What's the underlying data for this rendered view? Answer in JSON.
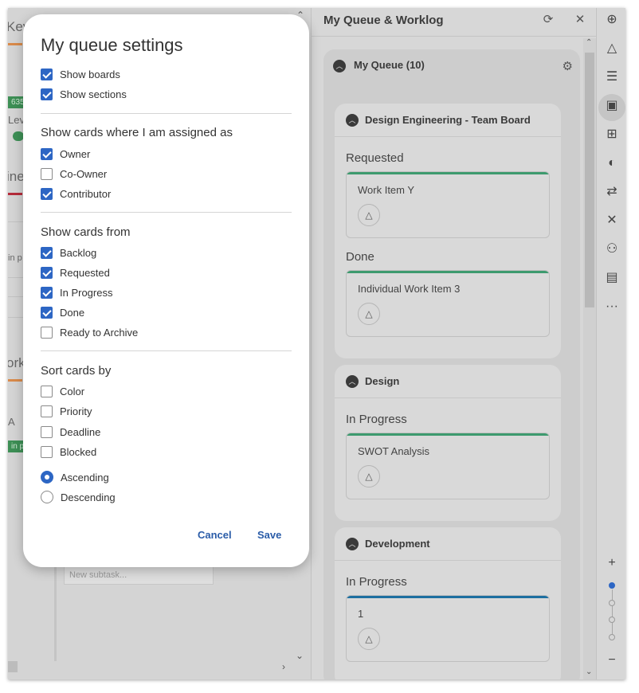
{
  "left_board": {
    "key_text": "Key",
    "id_badge": "635",
    "level_text": "Lev",
    "in_text": "in p",
    "ine_text": "ine",
    "work_text": "ork",
    "a_text": "A",
    "in_p_badge": "in pr",
    "new_subtask_placeholder": "New subtask..."
  },
  "panel": {
    "title": "My Queue & Worklog",
    "queue_title": "My Queue (10)",
    "boards": [
      {
        "title": "Design Engineering - Team Board",
        "columns": [
          {
            "label": "Requested",
            "card": "Work Item Y",
            "bar_color": "#3d9a6e"
          },
          {
            "label": "Done",
            "card": "Individual Work Item 3",
            "bar_color": "#3d9a6e"
          }
        ]
      },
      {
        "title": "Design",
        "columns": [
          {
            "label": "In Progress",
            "card": "SWOT Analysis",
            "bar_color": "#3d9a6e"
          }
        ]
      },
      {
        "title": "Development",
        "columns": [
          {
            "label": "In Progress",
            "card": "1",
            "bar_color": "#1d6fa0"
          }
        ]
      }
    ]
  },
  "toolbar": {
    "more_label": "···",
    "zoom_in": "+",
    "zoom_out": "−"
  },
  "modal": {
    "title": "My queue settings",
    "show_boards": "Show boards",
    "show_sections": "Show sections",
    "assigned_title": "Show cards where I am assigned as",
    "owner": "Owner",
    "co_owner": "Co-Owner",
    "contributor": "Contributor",
    "from_title": "Show cards from",
    "backlog": "Backlog",
    "requested": "Requested",
    "in_progress": "In Progress",
    "done": "Done",
    "ready_to_archive": "Ready to Archive",
    "sort_title": "Sort cards by",
    "color": "Color",
    "priority": "Priority",
    "deadline": "Deadline",
    "blocked": "Blocked",
    "ascending": "Ascending",
    "descending": "Descending",
    "cancel": "Cancel",
    "save": "Save",
    "checked": {
      "show_boards": true,
      "show_sections": true,
      "owner": true,
      "co_owner": false,
      "contributor": true,
      "backlog": true,
      "requested": true,
      "in_progress": true,
      "done": true,
      "ready_to_archive": false,
      "color": false,
      "priority": false,
      "deadline": false,
      "blocked": false,
      "ascending": true,
      "descending": false
    }
  },
  "colors": {
    "accent": "#2d66c4",
    "link": "#2a5ca8"
  }
}
